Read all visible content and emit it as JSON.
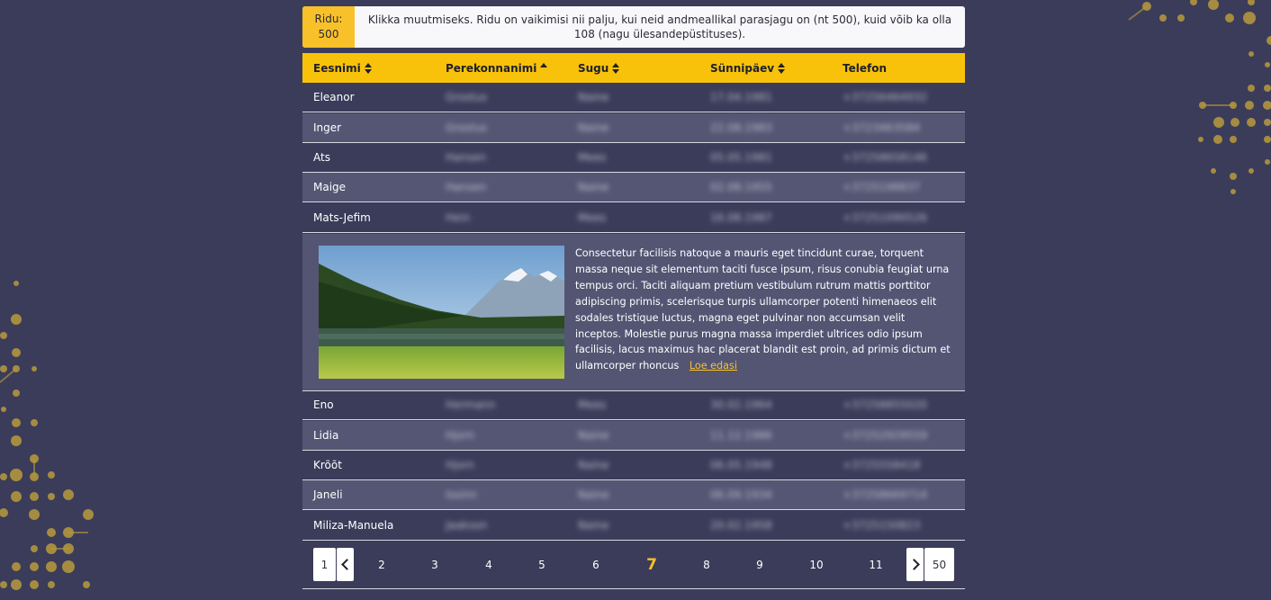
{
  "info": {
    "count_label": "Ridu:",
    "count_value": "500",
    "message": "Klikka muutmiseks. Ridu on vaikimisi nii palju, kui neid andmeallikal parasjagu on (nt 500), kuid võib ka olla 108 (nagu ülesandepüstituses)."
  },
  "table": {
    "headers": [
      {
        "label": "Eesnimi",
        "sort": "both"
      },
      {
        "label": "Perekonnanimi",
        "sort": "asc"
      },
      {
        "label": "Sugu",
        "sort": "both"
      },
      {
        "label": "Sünnipäev",
        "sort": "both"
      },
      {
        "label": "Telefon",
        "sort": "none"
      }
    ],
    "rows_before": [
      {
        "first": "Eleanor",
        "last": "Grostus",
        "gender": "Naine",
        "birthday": "17.04.1981",
        "phone": "+37256464932"
      },
      {
        "first": "Inger",
        "last": "Grostus",
        "gender": "Naine",
        "birthday": "22.08.1983",
        "phone": "+3723463584"
      },
      {
        "first": "Ats",
        "last": "Hansen",
        "gender": "Mees",
        "birthday": "05.05.1981",
        "phone": "+37258658146"
      },
      {
        "first": "Maige",
        "last": "Hansen",
        "gender": "Naine",
        "birthday": "02.08.1955",
        "phone": "+3725198837"
      },
      {
        "first": "Mats-Jefim",
        "last": "Hein",
        "gender": "Mees",
        "birthday": "16.08.1987",
        "phone": "+37251090526"
      }
    ],
    "detail": {
      "text": "Consectetur facilisis natoque a mauris eget tincidunt curae, torquent massa neque sit elementum taciti fusce ipsum, risus conubia feugiat urna tempus orci. Taciti aliquam pretium vestibulum rutrum mattis porttitor adipiscing primis, scelerisque turpis ullamcorper potenti himenaeos elit sodales tristique luctus, magna eget pulvinar non accumsan velit inceptos. Molestie purus magna massa imperdiet ultrices odio ipsum facilisis, lacus maximus hac placerat blandit est proin, ad primis dictum et ullamcorper rhoncus",
      "read_more": "Loe edasi"
    },
    "rows_after": [
      {
        "first": "Eno",
        "last": "Hermann",
        "gender": "Mees",
        "birthday": "30.02.1964",
        "phone": "+37258855020"
      },
      {
        "first": "Lidia",
        "last": "Hjorn",
        "gender": "Naine",
        "birthday": "11.12.1986",
        "phone": "+37252929559"
      },
      {
        "first": "Krõõt",
        "last": "Hjorn",
        "gender": "Naine",
        "birthday": "06.05.1948",
        "phone": "+3725558418"
      },
      {
        "first": "Janeli",
        "last": "Issinn",
        "gender": "Naine",
        "birthday": "06.09.1934",
        "phone": "+37258669714"
      },
      {
        "first": "Miliza-Manuela",
        "last": "Jaakson",
        "gender": "Naine",
        "birthday": "20.02.1958",
        "phone": "+3725150823"
      }
    ]
  },
  "pagination": {
    "first": "1",
    "pages": [
      "2",
      "3",
      "4",
      "5",
      "6",
      "7",
      "8",
      "9",
      "10",
      "11"
    ],
    "current": "7",
    "last": "50"
  },
  "colors": {
    "background": "#3b3c5a",
    "accent": "#f8c12a",
    "alt_row": "#555674"
  }
}
